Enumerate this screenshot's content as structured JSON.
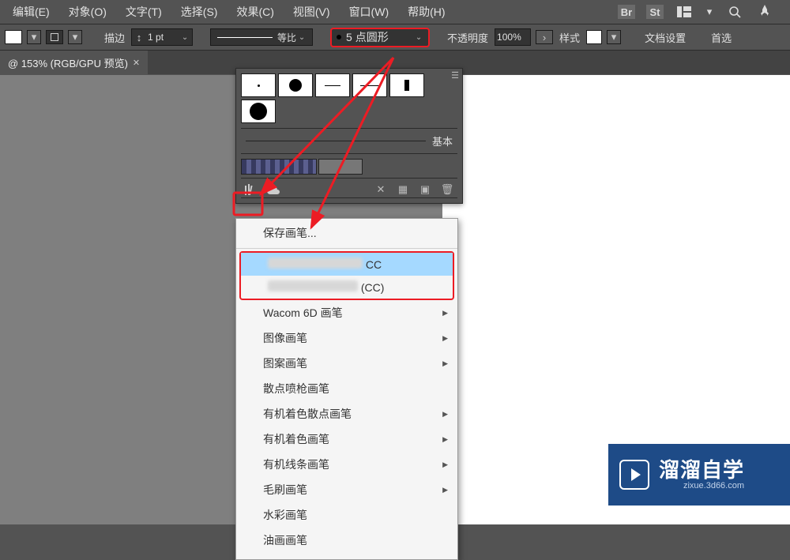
{
  "menubar": {
    "items": [
      "编辑(E)",
      "对象(O)",
      "文字(T)",
      "选择(S)",
      "效果(C)",
      "视图(V)",
      "窗口(W)",
      "帮助(H)"
    ],
    "right_icons": [
      "Br",
      "St",
      "workspace",
      "search",
      "rocket"
    ]
  },
  "optbar": {
    "stroke_label": "描边",
    "stroke_value": "1 pt",
    "profile_label": "等比",
    "brush_value": "5 点圆形",
    "opacity_label": "不透明度",
    "opacity_value": "100%",
    "style_label": "样式",
    "docsetup_label": "文档设置",
    "prefs_label": "首选"
  },
  "tab": {
    "label": "@ 153% (RGB/GPU 预览)"
  },
  "brush_panel": {
    "basic_label": "基本"
  },
  "ctx_menu": {
    "save_brush": "保存画笔...",
    "highlight1_suffix": "CC",
    "highlight2_suffix": "(CC)",
    "items": [
      {
        "label": "Wacom 6D 画笔",
        "arrow": true
      },
      {
        "label": "图像画笔",
        "arrow": true
      },
      {
        "label": "图案画笔",
        "arrow": true
      },
      {
        "label": "散点喷枪画笔",
        "arrow": false
      },
      {
        "label": "有机着色散点画笔",
        "arrow": true
      },
      {
        "label": "有机着色画笔",
        "arrow": true
      },
      {
        "label": "有机线条画笔",
        "arrow": true
      },
      {
        "label": "毛刷画笔",
        "arrow": true
      },
      {
        "label": "水彩画笔",
        "arrow": false
      },
      {
        "label": "油画画笔",
        "arrow": false
      }
    ]
  },
  "watermark": {
    "title": "溜溜自学",
    "url": "zixue.3d66.com"
  },
  "colors": {
    "highlight_red": "#ec1c24",
    "brand_blue": "#1e4b87"
  }
}
